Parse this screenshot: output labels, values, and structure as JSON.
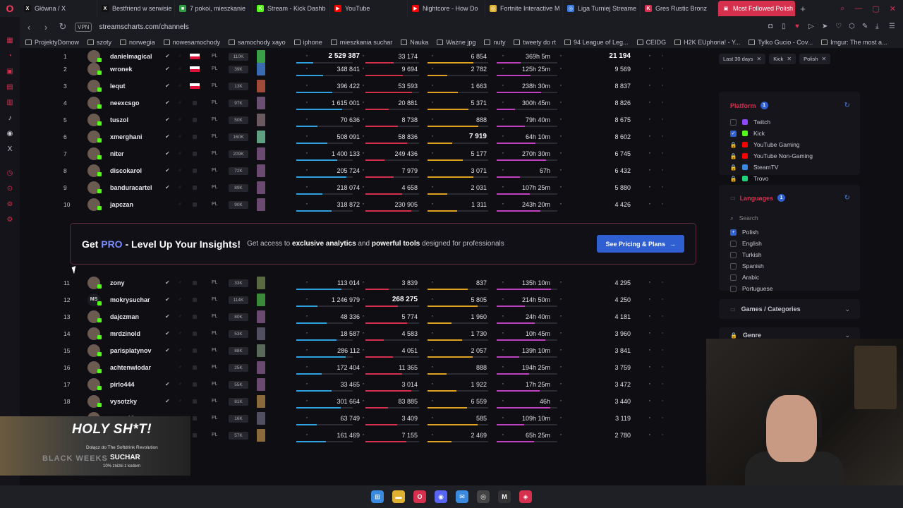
{
  "browser": {
    "tabs": [
      {
        "label": "Główna / X",
        "color": "#111111",
        "glyph": "X"
      },
      {
        "label": "Bestfriend w serwisie",
        "color": "#111111",
        "glyph": "X"
      },
      {
        "label": "7 pokoi, mieszkanie",
        "color": "#2ea043",
        "glyph": "■"
      },
      {
        "label": "Stream - Kick Dashb",
        "color": "#53fc18",
        "glyph": "K"
      },
      {
        "label": "YouTube",
        "color": "#ff0000",
        "glyph": "▶"
      },
      {
        "label": "Nightcore - How Do",
        "color": "#ff0000",
        "glyph": "▶"
      },
      {
        "label": "Fortnite Interactive M",
        "color": "#e0b030",
        "glyph": "◎"
      },
      {
        "label": "Liga Turniej Streame",
        "color": "#3a7ae0",
        "glyph": "◎"
      },
      {
        "label": "Gres Rustic Bronz",
        "color": "#d6304f",
        "glyph": "K"
      },
      {
        "label": "Most Followed Polish Kic",
        "color": "#d6304f",
        "glyph": "▣"
      }
    ],
    "vpn": "VPN",
    "url": "streamscharts.com/channels",
    "bookmarks": [
      "ProjektyDomow",
      "szoty",
      "norwegia",
      "nowesamochody",
      "samochody xayo",
      "iphone",
      "mieszkania suchar",
      "Nauka",
      "Ważne jpg",
      "nuty",
      "tweety do rt",
      "94 League of Leg...",
      "CEIDG",
      "H2K EUphoria! - Y...",
      "Tylko Gucio - Cov...",
      "Imgur: The most a..."
    ]
  },
  "ranking": {
    "rows": [
      {
        "rank": "1",
        "name": "danielmagical",
        "flag": "pl",
        "lang": "PL",
        "followers": "110K",
        "c1": "2 529 387",
        "c2": "33 174",
        "c3": "6 854",
        "c4": "369h 5m",
        "c5": "21 194",
        "bold1": true,
        "bold5": true,
        "verified": true
      },
      {
        "rank": "2",
        "name": "wronek",
        "flag": "pl",
        "lang": "PL",
        "followers": "39K",
        "c1": "348 841",
        "c2": "9 694",
        "c3": "2 782",
        "c4": "125h 25m",
        "c5": "9 569",
        "verified": true
      },
      {
        "rank": "3",
        "name": "lequt",
        "flag": "pl",
        "lang": "PL",
        "followers": "13K",
        "c1": "396 422",
        "c2": "53 593",
        "c3": "1 663",
        "c4": "238h 30m",
        "c5": "8 837",
        "verified": true
      },
      {
        "rank": "4",
        "name": "neexcsgo",
        "flag": "dim",
        "lang": "PL",
        "followers": "97K",
        "c1": "1 615 001",
        "c2": "20 881",
        "c3": "5 371",
        "c4": "300h 45m",
        "c5": "8 826",
        "verified": true
      },
      {
        "rank": "5",
        "name": "tuszol",
        "flag": "dim",
        "lang": "PL",
        "followers": "50K",
        "c1": "70 636",
        "c2": "8 738",
        "c3": "888",
        "c4": "79h 40m",
        "c5": "8 675",
        "verified": true
      },
      {
        "rank": "6",
        "name": "xmerghani",
        "flag": "dim",
        "lang": "PL",
        "followers": "160K",
        "c1": "508 091",
        "c2": "58 836",
        "c3": "7 919",
        "c4": "64h 10m",
        "c5": "8 602",
        "bold3": true,
        "verified": true
      },
      {
        "rank": "7",
        "name": "niter",
        "flag": "dim",
        "lang": "PL",
        "followers": "209K",
        "c1": "1 400 133",
        "c2": "249 436",
        "c3": "5 177",
        "c4": "270h 30m",
        "c5": "6 745",
        "verified": true
      },
      {
        "rank": "8",
        "name": "discokarol",
        "flag": "dim",
        "lang": "PL",
        "followers": "72K",
        "c1": "205 724",
        "c2": "7 979",
        "c3": "3 071",
        "c4": "67h",
        "c5": "6 432",
        "verified": true
      },
      {
        "rank": "9",
        "name": "banduracartel",
        "flag": "dim",
        "lang": "PL",
        "followers": "89K",
        "c1": "218 074",
        "c2": "4 658",
        "c3": "2 031",
        "c4": "107h 25m",
        "c5": "5 880",
        "verified": true
      },
      {
        "rank": "10",
        "name": "japczan",
        "flag": "dim",
        "lang": "PL",
        "followers": "90K",
        "c1": "318 872",
        "c2": "230 905",
        "c3": "1 311",
        "c4": "243h 20m",
        "c5": "4 426",
        "verified": false
      },
      {
        "rank": "11",
        "name": "zony",
        "flag": "dim",
        "lang": "PL",
        "followers": "33K",
        "c1": "113 014",
        "c2": "3 839",
        "c3": "837",
        "c4": "135h 10m",
        "c5": "4 295",
        "verified": true
      },
      {
        "rank": "12",
        "name": "mokrysuchar",
        "flag": "dim",
        "lang": "PL",
        "followers": "114K",
        "c1": "1 246 979",
        "c2": "268 275",
        "c3": "5 805",
        "c4": "214h 50m",
        "c5": "4 250",
        "bold2": true,
        "verified": true,
        "mono": "MS"
      },
      {
        "rank": "13",
        "name": "dajczman",
        "flag": "dim",
        "lang": "PL",
        "followers": "80K",
        "c1": "48 336",
        "c2": "5 774",
        "c3": "1 960",
        "c4": "24h 40m",
        "c5": "4 181",
        "verified": true
      },
      {
        "rank": "14",
        "name": "mrdzinold",
        "flag": "dim",
        "lang": "PL",
        "followers": "53K",
        "c1": "18 587",
        "c2": "4 583",
        "c3": "1 730",
        "c4": "10h 45m",
        "c5": "3 960",
        "verified": true
      },
      {
        "rank": "15",
        "name": "parisplatynov",
        "flag": "dim",
        "lang": "PL",
        "followers": "88K",
        "c1": "286 112",
        "c2": "4 051",
        "c3": "2 057",
        "c4": "139h 10m",
        "c5": "3 841",
        "verified": true
      },
      {
        "rank": "16",
        "name": "achtenwlodar",
        "flag": "dim",
        "lang": "PL",
        "followers": "25K",
        "c1": "172 404",
        "c2": "11 365",
        "c3": "888",
        "c4": "194h 25m",
        "c5": "3 759",
        "verified": false
      },
      {
        "rank": "17",
        "name": "pirlo444",
        "flag": "dim",
        "lang": "PL",
        "followers": "55K",
        "c1": "33 465",
        "c2": "3 014",
        "c3": "1 922",
        "c4": "17h 25m",
        "c5": "3 472",
        "verified": true
      },
      {
        "rank": "18",
        "name": "vysotzky",
        "flag": "dim",
        "lang": "PL",
        "followers": "81K",
        "c1": "301 664",
        "c2": "83 885",
        "c3": "6 559",
        "c4": "46h",
        "c5": "3 440",
        "verified": true
      },
      {
        "rank": "19",
        "name": "pevor13",
        "flag": "dim",
        "lang": "PL",
        "followers": "16K",
        "c1": "63 749",
        "c2": "3 409",
        "c3": "585",
        "c4": "109h 10m",
        "c5": "3 119",
        "verified": false
      },
      {
        "rank": "",
        "name": "",
        "flag": "dim",
        "lang": "PL",
        "followers": "57K",
        "c1": "161 469",
        "c2": "7 155",
        "c3": "2 469",
        "c4": "65h 25m",
        "c5": "2 780",
        "verified": false
      }
    ]
  },
  "pro_banner": {
    "head_prefix": "Get ",
    "head_highlight": "PRO",
    "head_suffix": " - Level Up Your Insights!",
    "desc_1": "Get access to ",
    "desc_bold_1": "exclusive analytics",
    "desc_2": " and ",
    "desc_bold_2": "powerful tools",
    "desc_3": " designed for professionals",
    "button": "See Pricing & Plans"
  },
  "filters": {
    "chips": [
      "Last 30 days",
      "Kick",
      "Polish"
    ],
    "platform": {
      "title": "Platform",
      "count": "1",
      "options": [
        {
          "label": "Twitch",
          "state": "off",
          "color": "#9146ff"
        },
        {
          "label": "Kick",
          "state": "on",
          "color": "#53fc18"
        },
        {
          "label": "YouTube Gaming",
          "state": "lock",
          "color": "#ff0000"
        },
        {
          "label": "YouTube Non-Gaming",
          "state": "lock",
          "color": "#ff0000"
        },
        {
          "label": "SteamTV",
          "state": "lock",
          "color": "#3a8ae0"
        },
        {
          "label": "Trovo",
          "state": "lock",
          "color": "#21d37a"
        }
      ]
    },
    "languages": {
      "title": "Languages",
      "count": "1",
      "search_placeholder": "Search",
      "options": [
        {
          "label": "Polish",
          "state": "on"
        },
        {
          "label": "English",
          "state": "off"
        },
        {
          "label": "Turkish",
          "state": "off"
        },
        {
          "label": "Spanish",
          "state": "off"
        },
        {
          "label": "Arabic",
          "state": "off"
        },
        {
          "label": "Portuguese",
          "state": "off"
        }
      ]
    },
    "games_title": "Games / Categories",
    "genre_title": "Genre"
  },
  "promo": {
    "title": "HOLY SH*T!",
    "sub": "Dołącz do The Softdrink Revolution",
    "brand": "SUCHAR",
    "small": "10% zniżki z kodem",
    "black": "BLACK WEEKS"
  },
  "taskbar": {
    "icons": [
      {
        "name": "windows-start-icon",
        "color": "#3a8ae0",
        "glyph": "⊞"
      },
      {
        "name": "file-explorer-icon",
        "color": "#e0b030",
        "glyph": "▬"
      },
      {
        "name": "opera-icon",
        "color": "#d6304f",
        "glyph": "O"
      },
      {
        "name": "discord-icon",
        "color": "#5865f2",
        "glyph": "◉"
      },
      {
        "name": "messenger-icon",
        "color": "#3a8ae0",
        "glyph": "✉"
      },
      {
        "name": "opera-gx-icon",
        "color": "#444",
        "glyph": "◎"
      },
      {
        "name": "msi-icon",
        "color": "#333",
        "glyph": "M"
      },
      {
        "name": "obs-icon",
        "color": "#d6304f",
        "glyph": "◈"
      }
    ]
  }
}
